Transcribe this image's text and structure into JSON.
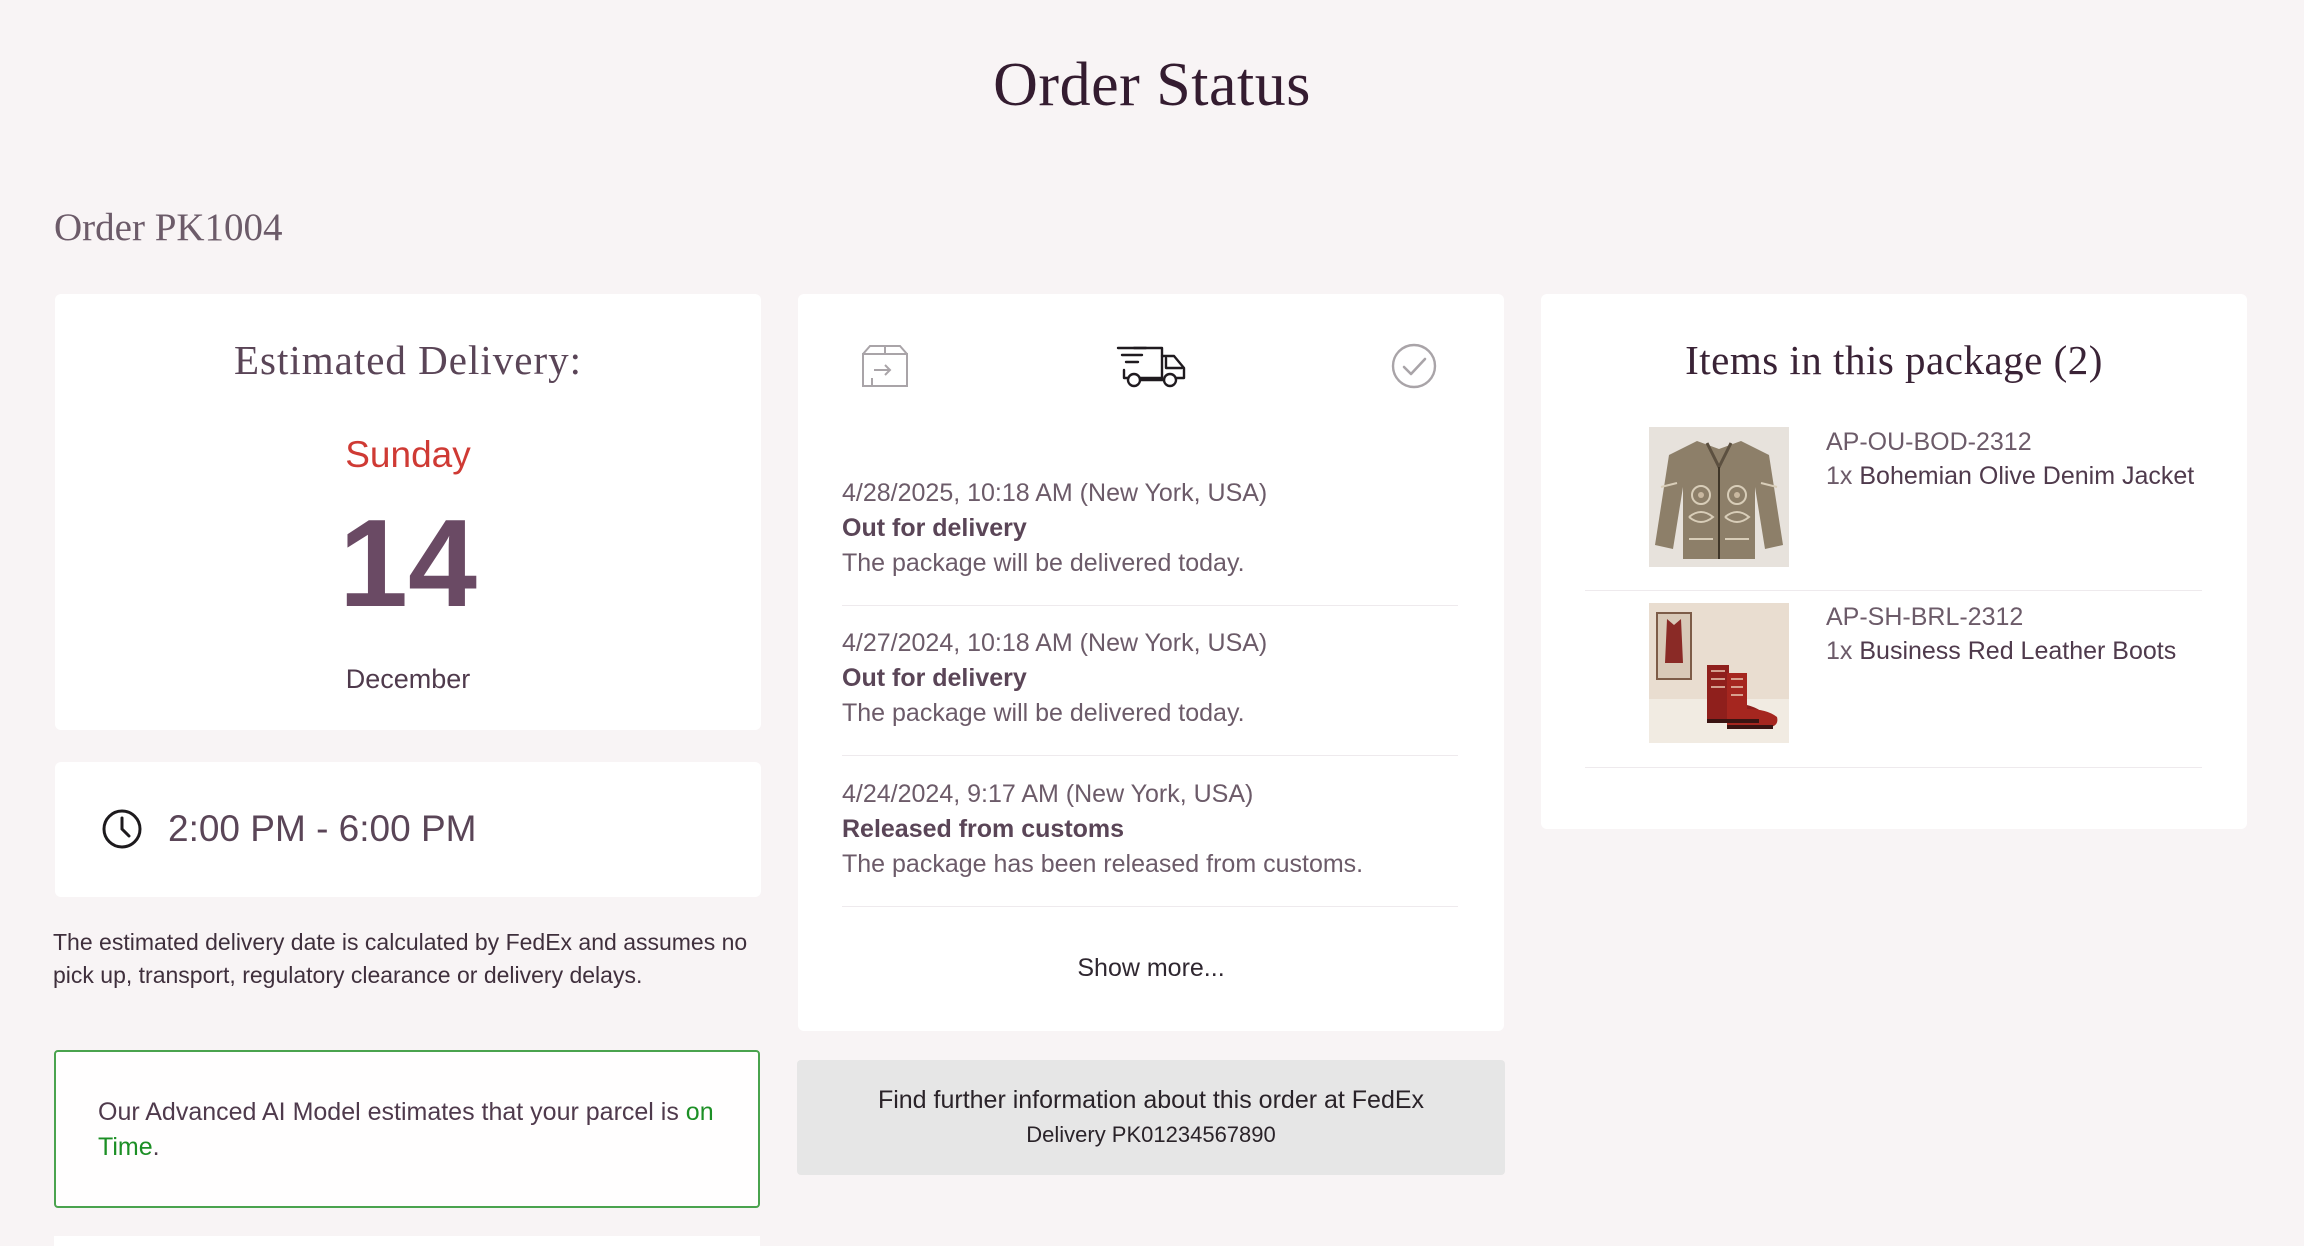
{
  "page": {
    "title": "Order Status",
    "order_label": "Order PK1004"
  },
  "estimate": {
    "title": "Estimated Delivery:",
    "weekday": "Sunday",
    "day": "14",
    "month": "December",
    "time_window": "2:00 PM - 6:00 PM",
    "disclaimer": "The estimated delivery date is calculated by FedEx and assumes no pick up, transport, regulatory clearance or delivery delays."
  },
  "ai": {
    "prefix": "Our Advanced AI Model estimates that your parcel is ",
    "status": "on Time",
    "suffix": ".",
    "status_color": "#1c8f25"
  },
  "timeline": {
    "icons": [
      "box-icon",
      "delivery-truck-icon",
      "check-circle-icon"
    ],
    "events": [
      {
        "time": "4/28/2025, 10:18 AM (New York, USA)",
        "status": "Out for delivery",
        "description": "The package will be delivered today."
      },
      {
        "time": "4/27/2024, 10:18 AM (New York, USA)",
        "status": "Out for delivery",
        "description": "The package will be delivered today."
      },
      {
        "time": "4/24/2024, 9:17 AM (New York, USA)",
        "status": "Released from customs",
        "description": "The package has been released from customs."
      }
    ],
    "show_more": "Show more..."
  },
  "fedex": {
    "line1": "Find further information about this order at FedEx",
    "line2": "Delivery PK01234567890"
  },
  "items": {
    "title": "Items in this package (2)",
    "list": [
      {
        "sku": "AP-OU-BOD-2312",
        "qty": "1x",
        "name": "Bohemian Olive Denim Jacket"
      },
      {
        "sku": "AP-SH-BRL-2312",
        "qty": "1x",
        "name": "Business Red Leather Boots"
      }
    ]
  },
  "colors": {
    "accent_red": "#cf3a34",
    "success_green": "#1c8f25",
    "heading": "#341c30"
  }
}
